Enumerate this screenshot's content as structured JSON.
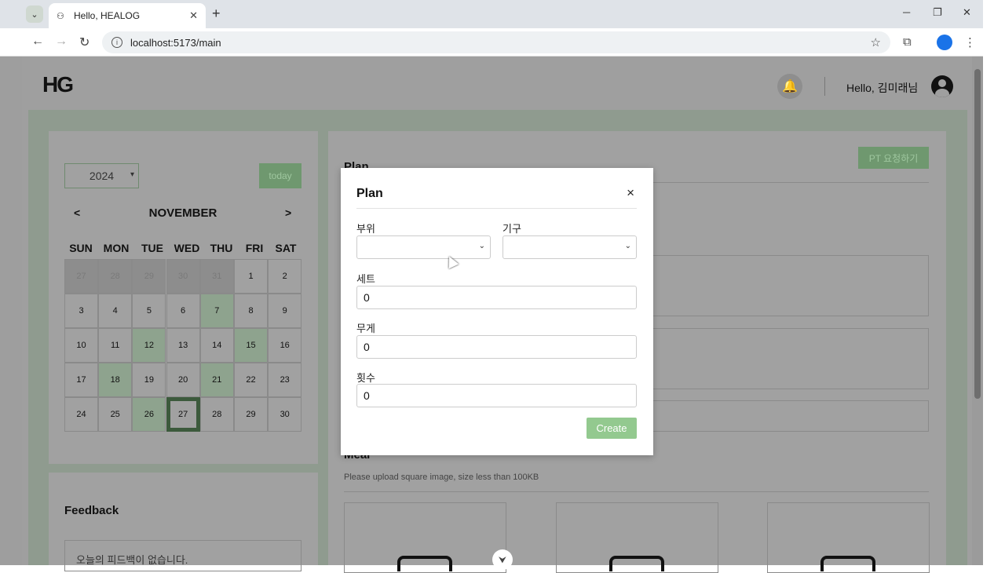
{
  "browser": {
    "tab_title": "Hello, HEALOG",
    "url": "localhost:5173/main"
  },
  "header": {
    "logo": "HG",
    "greeting": "Hello, 김미래님"
  },
  "calendar": {
    "year": "2024",
    "today_label": "today",
    "month": "NOVEMBER",
    "prev": "<",
    "next": ">",
    "weekdays": [
      "SUN",
      "MON",
      "TUE",
      "WED",
      "THU",
      "FRI",
      "SAT"
    ],
    "days": [
      [
        "27",
        "28",
        "29",
        "30",
        "31",
        "1",
        "2"
      ],
      [
        "3",
        "4",
        "5",
        "6",
        "7",
        "8",
        "9"
      ],
      [
        "10",
        "11",
        "12",
        "13",
        "14",
        "15",
        "16"
      ],
      [
        "17",
        "18",
        "19",
        "20",
        "21",
        "22",
        "23"
      ],
      [
        "24",
        "25",
        "26",
        "27",
        "28",
        "29",
        "30"
      ]
    ]
  },
  "feedback": {
    "title": "Feedback",
    "empty": "오늘의 피드백이 없습니다."
  },
  "main": {
    "pt_button": "PT 요청하기",
    "plan_heading": "Plan",
    "meal_heading": "Meal",
    "meal_hint": "Please upload square image, size less than 100KB"
  },
  "modal": {
    "title": "Plan",
    "close": "×",
    "part_label": "부위",
    "equipment_label": "기구",
    "sets_label": "세트",
    "sets_value": "0",
    "weight_label": "무게",
    "weight_value": "0",
    "reps_label": "횟수",
    "reps_value": "0",
    "create": "Create"
  }
}
